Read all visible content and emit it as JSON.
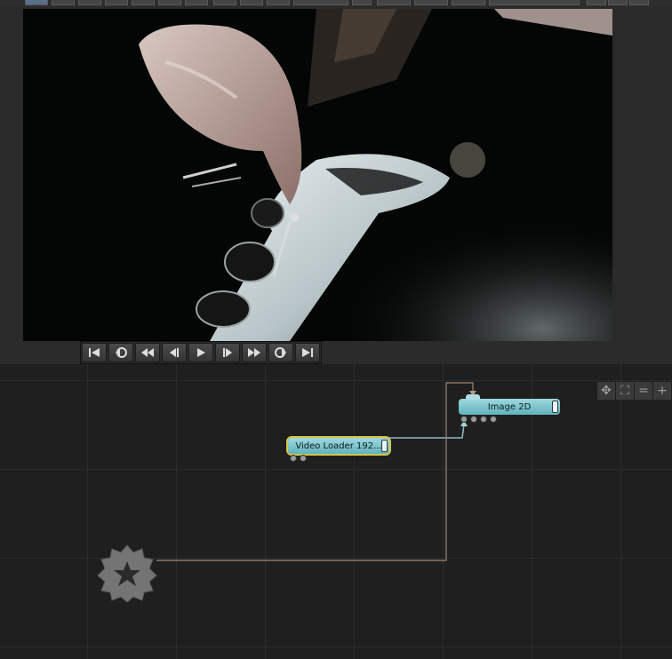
{
  "viewer": {
    "image_alt": "guitarist-video-frame"
  },
  "transport": {
    "buttons": [
      {
        "name": "go-to-start",
        "icon": "skip-start-icon"
      },
      {
        "name": "previous-keyframe",
        "icon": "prev-key-icon"
      },
      {
        "name": "rewind",
        "icon": "rewind-icon"
      },
      {
        "name": "step-back",
        "icon": "step-back-icon"
      },
      {
        "name": "play",
        "icon": "play-icon"
      },
      {
        "name": "step-forward",
        "icon": "step-forward-icon"
      },
      {
        "name": "fast-forward",
        "icon": "fast-forward-icon"
      },
      {
        "name": "next-keyframe",
        "icon": "next-key-icon"
      },
      {
        "name": "go-to-end",
        "icon": "skip-end-icon"
      }
    ]
  },
  "nodes": {
    "image2d": {
      "label": "Image  2D"
    },
    "video_loader": {
      "label": "Video  Loader  192..."
    }
  },
  "view_tools": {
    "move": "✥",
    "fit": "⛶",
    "align": "=",
    "add": "+"
  },
  "colors": {
    "node_fill": "#7cc6cf",
    "wire": "#8fb9c6",
    "selected": "#d6c64a"
  }
}
